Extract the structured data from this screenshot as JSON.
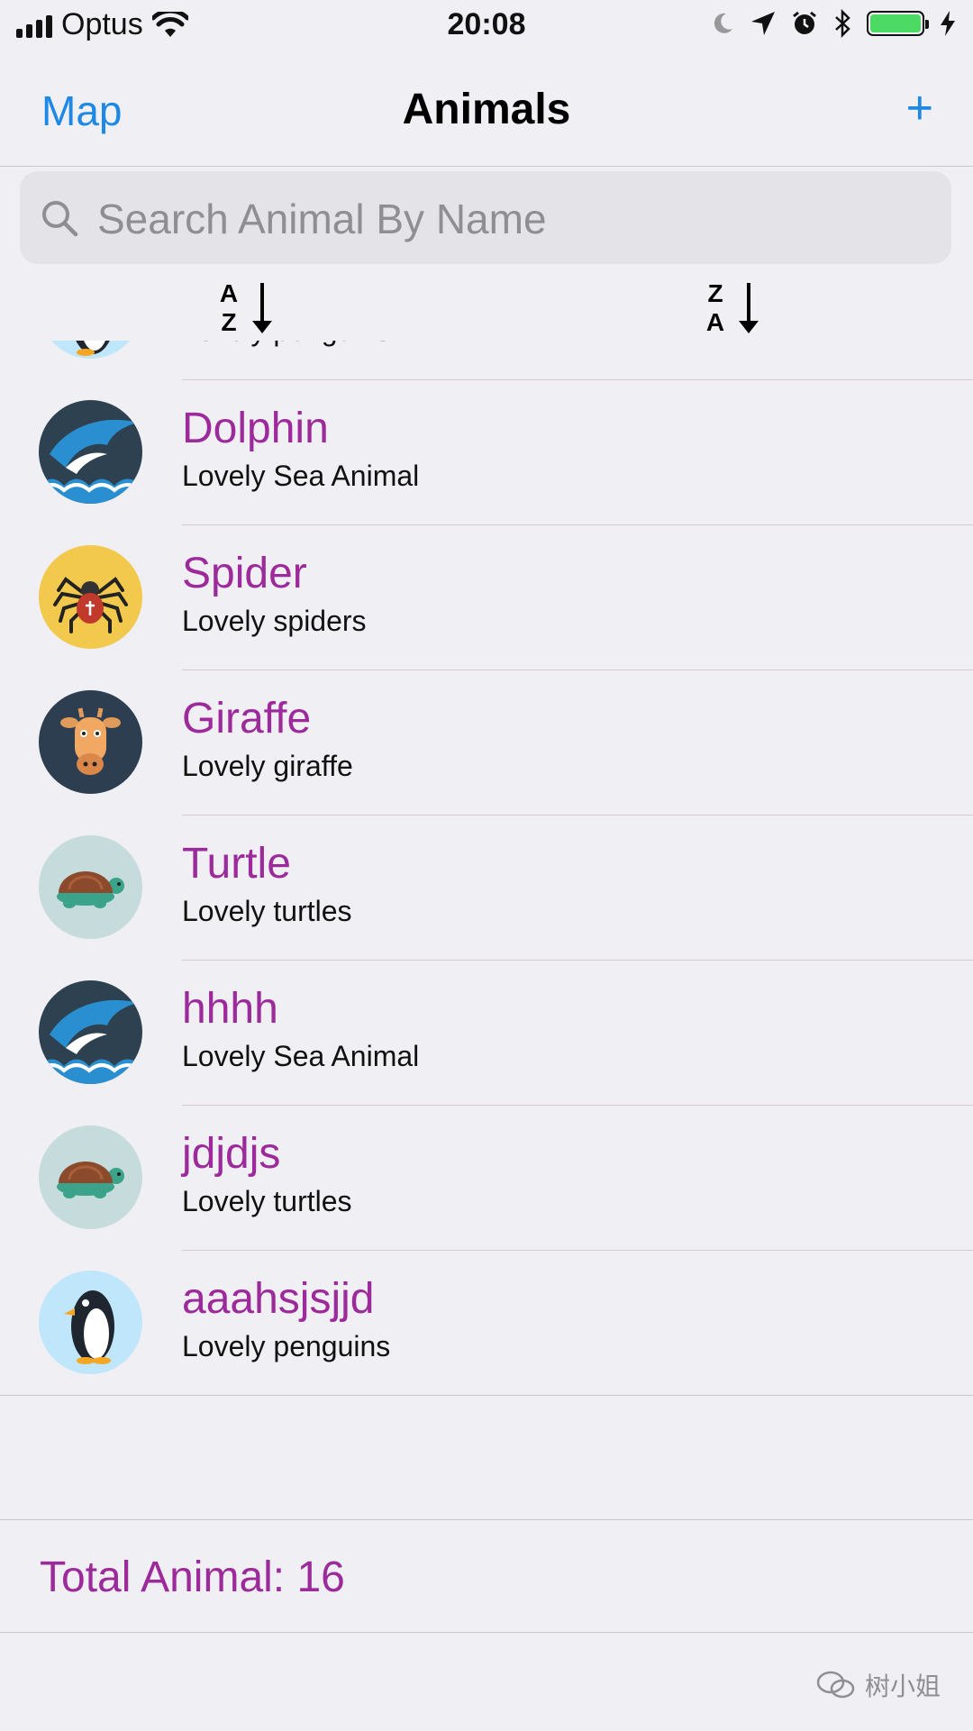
{
  "status_bar": {
    "carrier": "Optus",
    "time": "20:08",
    "battery_color": "#4cd964"
  },
  "nav": {
    "left_label": "Map",
    "title": "Animals",
    "right_label": "+",
    "accent_color": "#1e88e5"
  },
  "search": {
    "placeholder": "Search Animal By Name",
    "icon": "search-icon"
  },
  "sort": {
    "az": {
      "top": "A",
      "bottom": "Z",
      "icon": "arrow-down-icon"
    },
    "za": {
      "top": "Z",
      "bottom": "A",
      "icon": "arrow-down-icon"
    }
  },
  "animals": [
    {
      "name": "",
      "description": "Lovely penguins",
      "icon": "penguin-icon"
    },
    {
      "name": "Dolphin",
      "description": "Lovely Sea Animal",
      "icon": "dolphin-icon"
    },
    {
      "name": "Spider",
      "description": "Lovely spiders",
      "icon": "spider-icon"
    },
    {
      "name": "Giraffe",
      "description": "Lovely giraffe",
      "icon": "giraffe-icon"
    },
    {
      "name": "Turtle",
      "description": "Lovely turtles",
      "icon": "turtle-icon"
    },
    {
      "name": "hhhh",
      "description": "Lovely Sea Animal",
      "icon": "dolphin-icon"
    },
    {
      "name": "jdjdjs",
      "description": "Lovely turtles",
      "icon": "turtle-icon"
    },
    {
      "name": "aaahsjsjjd",
      "description": "Lovely penguins",
      "icon": "penguin-icon"
    }
  ],
  "footer": {
    "total_label": "Total Animal: 16"
  },
  "watermark": {
    "text": "树小姐"
  },
  "colors": {
    "title_purple": "#9c2a9a",
    "background": "#efeff4"
  }
}
